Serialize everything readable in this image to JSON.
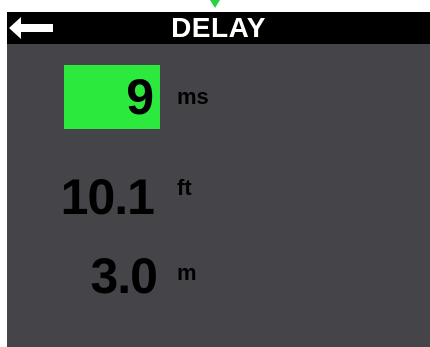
{
  "header": {
    "title": "DELAY",
    "back_icon": "left-arrow-icon"
  },
  "delay": {
    "ms_value": "9",
    "ms_unit": "ms",
    "ft_value": "10.1",
    "ft_unit": "ft",
    "m_value": "3.0",
    "m_unit": "m"
  },
  "colors": {
    "background": "#454449",
    "header": "#000000",
    "selected": "#2ce93d",
    "marker": "#29d245"
  }
}
